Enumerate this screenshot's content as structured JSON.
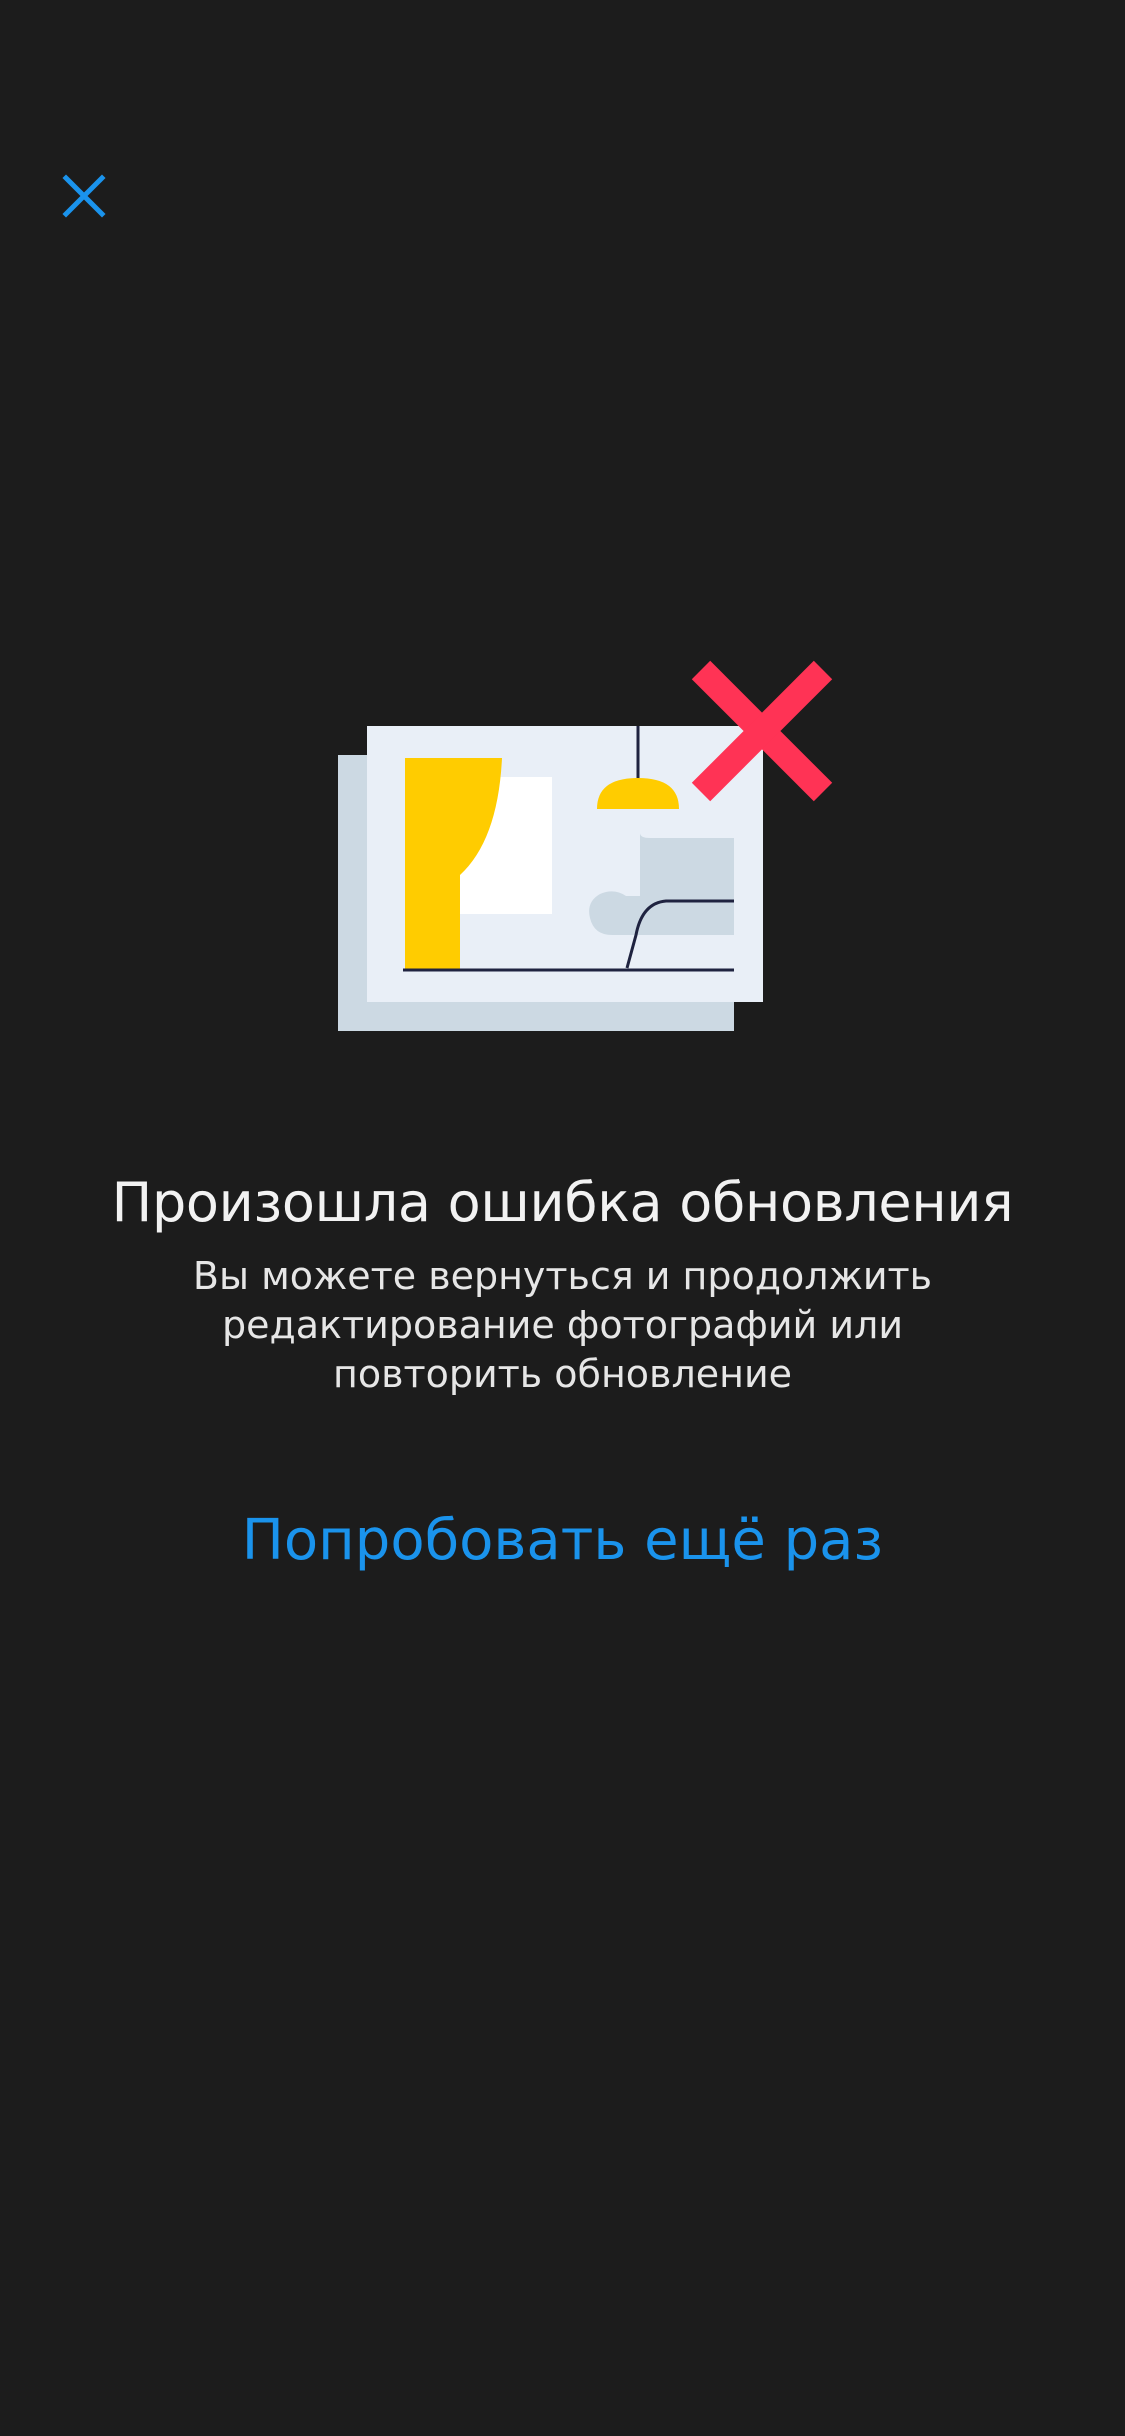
{
  "header": {
    "close_icon": "close-icon"
  },
  "illustration": {
    "name": "photo-error-illustration",
    "colors": {
      "back_card": "#ccd9e3",
      "front_card": "#e9eff7",
      "curtain": "#ffcc00",
      "window": "#ffffff",
      "lamp": "#ffcc00",
      "sofa": "#ccd9e3",
      "line": "#1f2340",
      "error_cross": "#ff3355"
    }
  },
  "error": {
    "title": "Произошла ошибка обновления",
    "message": "Вы можете вернуться и продолжить редактирование фотографий или повторить обновление"
  },
  "actions": {
    "retry_label": "Попробовать ещё раз"
  },
  "colors": {
    "background": "#1c1c1c",
    "accent": "#1a93ec",
    "title": "#f2f2f2"
  }
}
